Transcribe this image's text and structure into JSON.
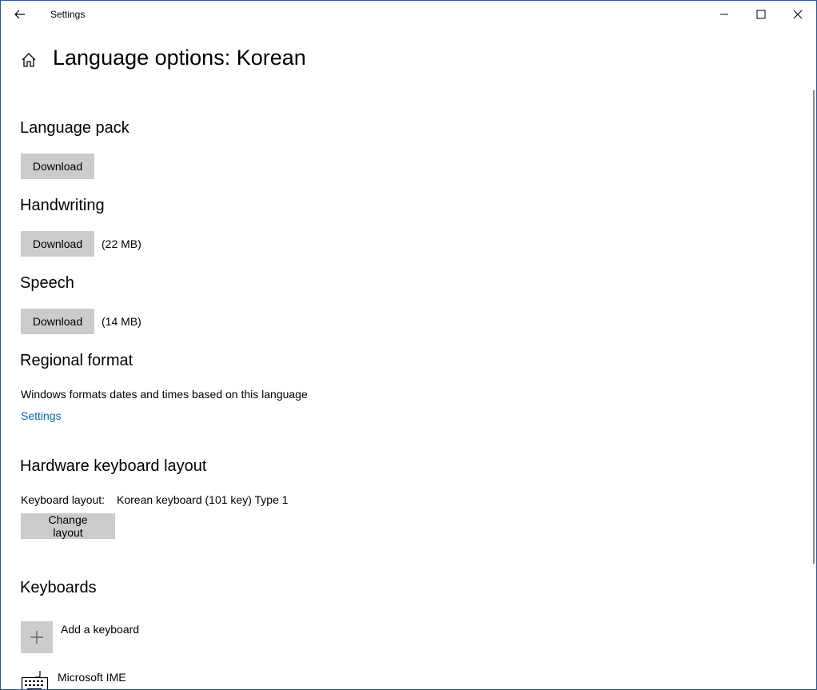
{
  "titlebar": {
    "title": "Settings",
    "back_icon": "back-arrow-icon",
    "minimize_icon": "minimize-icon",
    "maximize_icon": "maximize-icon",
    "close_icon": "close-icon"
  },
  "header": {
    "home_icon": "home-icon",
    "title": "Language options: Korean"
  },
  "language_pack": {
    "title": "Language pack",
    "button": "Download"
  },
  "handwriting": {
    "title": "Handwriting",
    "button": "Download",
    "size": "(22 MB)"
  },
  "speech": {
    "title": "Speech",
    "button": "Download",
    "size": "(14 MB)"
  },
  "regional_format": {
    "title": "Regional format",
    "description": "Windows formats dates and times based on this language",
    "link": "Settings"
  },
  "hardware_keyboard": {
    "title": "Hardware keyboard layout",
    "label": "Keyboard layout:",
    "value": "Korean keyboard (101 key) Type 1",
    "button": "Change layout"
  },
  "keyboards": {
    "title": "Keyboards",
    "add_label": "Add a keyboard",
    "add_icon": "plus-icon",
    "items": [
      {
        "name": "Microsoft IME",
        "icon": "keyboard-icon"
      }
    ]
  },
  "colors": {
    "button_bg": "#cccccc",
    "link": "#0067c0",
    "window_border": "#2b579a"
  }
}
